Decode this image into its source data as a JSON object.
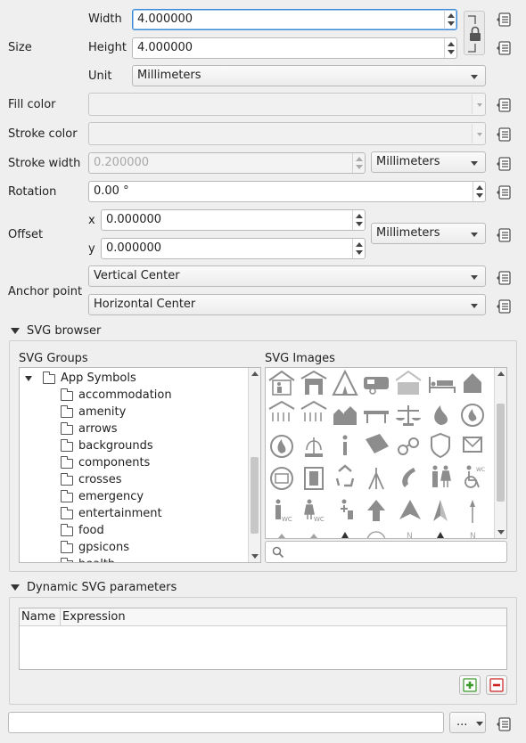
{
  "size": {
    "label": "Size",
    "width_label": "Width",
    "width_value": "4.000000",
    "height_label": "Height",
    "height_value": "4.000000",
    "unit_label": "Unit",
    "unit_value": "Millimeters"
  },
  "fill_color": {
    "label": "Fill color"
  },
  "stroke_color": {
    "label": "Stroke color"
  },
  "stroke_width": {
    "label": "Stroke width",
    "value": "0.200000",
    "unit": "Millimeters"
  },
  "rotation": {
    "label": "Rotation",
    "value": "0.00 °"
  },
  "offset": {
    "label": "Offset",
    "x_label": "x",
    "x_value": "0.000000",
    "y_label": "y",
    "y_value": "0.000000",
    "unit": "Millimeters"
  },
  "anchor_point": {
    "label": "Anchor point",
    "vertical": "Vertical Center",
    "horizontal": "Horizontal Center"
  },
  "svg_browser": {
    "title": "SVG browser",
    "groups_label": "SVG Groups",
    "images_label": "SVG Images",
    "root": "App Symbols",
    "groups": [
      "accommodation",
      "amenity",
      "arrows",
      "backgrounds",
      "components",
      "crosses",
      "emergency",
      "entertainment",
      "food",
      "gpsicons",
      "health"
    ],
    "search_placeholder": ""
  },
  "dynamic": {
    "title": "Dynamic SVG parameters",
    "col_name": "Name",
    "col_expression": "Expression"
  },
  "bottom": {
    "path_value": "",
    "browse_label": "..."
  },
  "icons": {
    "data_defined": "data-defined-override-icon",
    "lock": "lock-aspect-ratio-icon",
    "search": "search-icon",
    "add": "add-parameter-icon",
    "remove": "remove-parameter-icon"
  },
  "colors": {
    "accent": "#3b8ad8",
    "add_green": "#3a9a2a",
    "remove_red": "#cc2222"
  }
}
